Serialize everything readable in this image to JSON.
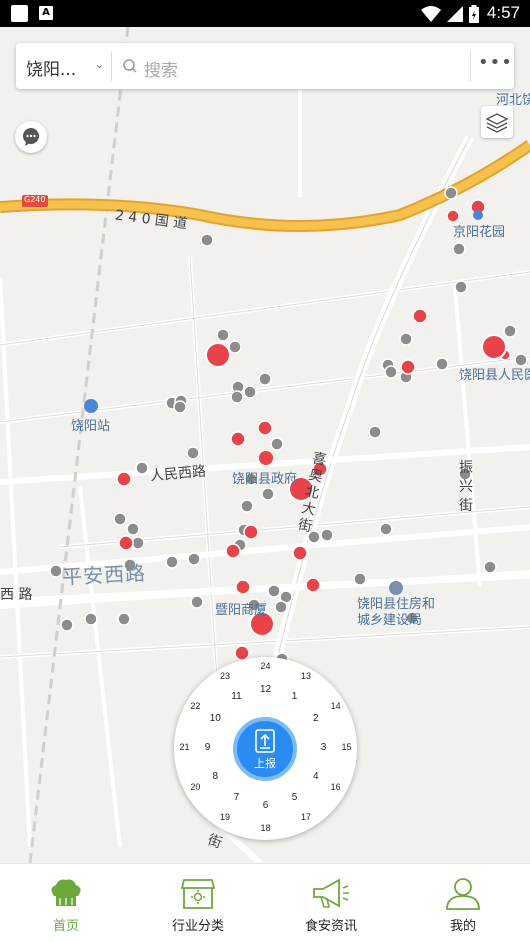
{
  "status": {
    "time": "4:57"
  },
  "search": {
    "city": "饶阳...",
    "placeholder": "搜索"
  },
  "map": {
    "labels": {
      "guodao": "2 4 0 国 道",
      "g240": "G240",
      "hebei": "河北饶",
      "jingyang": "京阳花园",
      "raoyang_people": "饶阳县人民医",
      "raoyang_station": "饶阳站",
      "renmin_west": "人民西路",
      "gov": "饶阳县政府",
      "xibei": "喜\n奥\n北\n大\n街",
      "fuxing": "振\n兴\n街",
      "pingan_west": "平安西路",
      "xi_lu": "西 路",
      "jiyang": "暨阳商厦",
      "housing": "饶阳县住房和\n城乡建设局",
      "jie": "街"
    }
  },
  "dial": {
    "report_label": "上报",
    "hours": [
      "24",
      "1",
      "2",
      "3",
      "4",
      "5",
      "6",
      "7",
      "8",
      "9",
      "10",
      "11",
      "12",
      "13",
      "14",
      "15",
      "16",
      "17",
      "18",
      "19",
      "20",
      "21",
      "22",
      "23"
    ]
  },
  "tabs": [
    {
      "label": "首页",
      "icon": "chef-hat-icon"
    },
    {
      "label": "行业分类",
      "icon": "shop-icon"
    },
    {
      "label": "食安资讯",
      "icon": "megaphone-icon"
    },
    {
      "label": "我的",
      "icon": "user-icon"
    }
  ],
  "colors": {
    "accent": "#6da93a",
    "marker_red": "#e8424a",
    "marker_gray": "#8c8c8c",
    "report_blue": "#2a8cf2",
    "highway": "#f0b33c"
  }
}
